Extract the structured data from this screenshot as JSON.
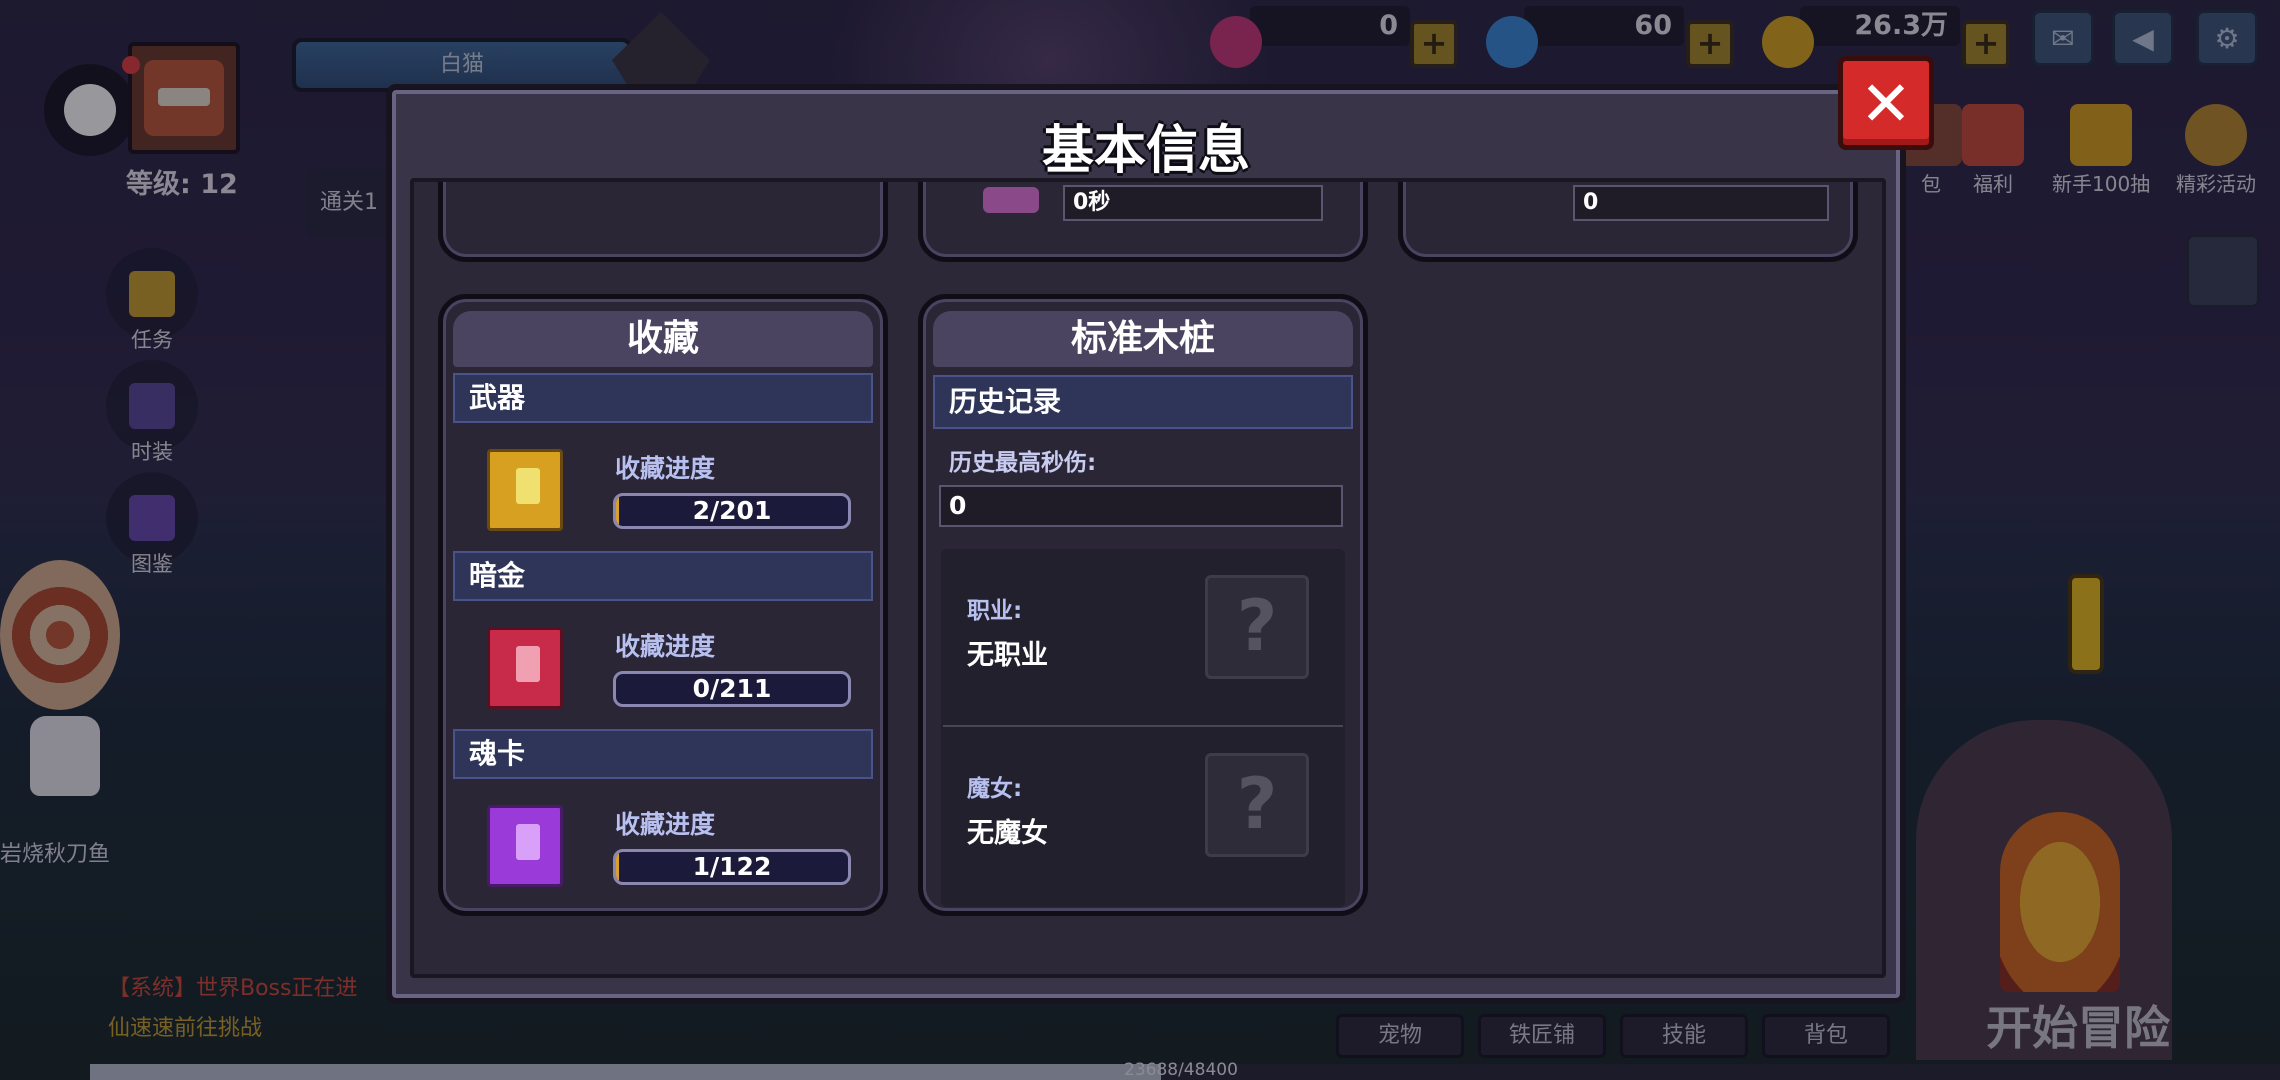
{
  "player": {
    "name": "白猫",
    "level_label": "等级: 12",
    "stage_label": "通关1"
  },
  "currencies": [
    {
      "name": "pink-gem",
      "value": "0",
      "color": "#c83a7a"
    },
    {
      "name": "blue-diamond",
      "value": "60",
      "color": "#3a8ad8"
    },
    {
      "name": "gold-coin",
      "value": "26.3万",
      "color": "#d8a820"
    }
  ],
  "left_menu": [
    {
      "label": "任务",
      "icon": "task-icon",
      "color": "#c8a030"
    },
    {
      "label": "时装",
      "icon": "costume-icon",
      "color": "#5a4a9a"
    },
    {
      "label": "图鉴",
      "icon": "codex-icon",
      "color": "#6a4ab0"
    }
  ],
  "right_menu": [
    {
      "label": "包",
      "icon": "gift-bag-icon"
    },
    {
      "label": "福利",
      "icon": "welfare-icon"
    },
    {
      "label": "新手100抽",
      "icon": "newbie-100-draw-icon"
    },
    {
      "label": "精彩活动",
      "icon": "events-icon"
    }
  ],
  "chat": {
    "line1": "【系统】世界Boss正在进",
    "line2": "仙速速前往挑战"
  },
  "pet_name": "岩烧秋刀鱼",
  "bottom_tabs": [
    "宠物",
    "铁匠铺",
    "技能",
    "背包"
  ],
  "start_label": "开始冒险",
  "xp": {
    "text": "23688/48400",
    "fraction": 0.489
  },
  "modal": {
    "title": "基本信息",
    "top_row": {
      "middle_value": "0秒",
      "right_value": "0"
    },
    "collection": {
      "title": "收藏",
      "sections": [
        {
          "label": "武器",
          "progress_label": "收藏进度",
          "progress_text": "2/201",
          "fraction": 0.01,
          "book_color": "#d8a020",
          "gem_color": "#f0e070"
        },
        {
          "label": "暗金",
          "progress_label": "收藏进度",
          "progress_text": "0/211",
          "fraction": 0.0,
          "book_color": "#c82a4a",
          "gem_color": "#f0a0b0"
        },
        {
          "label": "魂卡",
          "progress_label": "收藏进度",
          "progress_text": "1/122",
          "fraction": 0.008,
          "book_color": "#9a3ad8",
          "gem_color": "#d8a0f8"
        }
      ]
    },
    "dummy": {
      "title": "标准木桩",
      "section_label": "历史记录",
      "dps_label": "历史最高秒伤:",
      "dps_value": "0",
      "class_key": "职业:",
      "class_value": "无职业",
      "witch_key": "魔女:",
      "witch_value": "无魔女",
      "unknown_glyph": "?"
    },
    "close_glyph": "✕"
  }
}
